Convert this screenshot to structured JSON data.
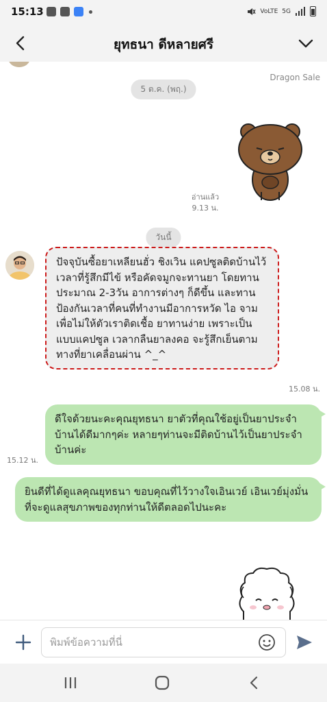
{
  "status_bar": {
    "time": "15:13",
    "network_label": "VoLTE",
    "signal_label": "5G"
  },
  "header": {
    "title": "ยุทธนา ดีหลายศรี",
    "back_icon": "chevron-left-icon",
    "menu_icon": "chevron-down-icon"
  },
  "chat": {
    "dragon_sale_label": "Dragon Sale",
    "date_old": "5 ต.ค. (พฤ.)",
    "read_label": "อ่านแล้ว",
    "read_time": "9.13 น.",
    "date_today": "วันนี้",
    "messages": [
      {
        "direction": "in",
        "text": "ปัจจุบันซื้อยาเหลียนฮั่ว ชิงเวิน แคปซูลติดบ้านไว้ เวลาที่รู้สึกมีไข้ หรือคัดจมูกจะทานยา โดยทานประมาณ 2-3วัน อาการต่างๆ ก็ดีขึ้น และทานป้องกันเวลาที่คนที่ทำงานมีอาการหวัด ไอ จาม เพื่อไม่ให้ตัวเราติดเชื้อ ยาทานง่าย เพราะเป็นแบบแคปซูล เวลากลืนยาลงคอ จะรู้สึกเย็นตามทางที่ยาเคลื่อนผ่าน ^_^",
        "time": "15.08 น."
      },
      {
        "direction": "out",
        "text": "ดีใจด้วยนะคะคุณยุทธนา ยาตัวที่คุณใช้อยู่เป็นยาประจำบ้านได้ดีมากๆค่ะ หลายๆท่านจะมีติดบ้านไว้เป็นยาประจำบ้านค่ะ",
        "time": "15.12 น."
      },
      {
        "direction": "out",
        "text": "ยินดีที่ได้ดูแลคุณยุทธนา ขอบคุณที่ไว้วางใจเอินเวย์ เอินเวย์มุ่งมั่นที่จะดูแลสุขภาพของทุกท่านให้ดีตลอดไปนะคะ",
        "time": ""
      }
    ]
  },
  "input_bar": {
    "placeholder": "พิมพ์ข้อความที่นี่",
    "value": "",
    "plus_icon": "plus-icon",
    "emoji_icon": "emoji-icon",
    "send_icon": "send-icon"
  },
  "nav_bar": {
    "icons": [
      "recent-apps-icon",
      "home-icon",
      "back-icon"
    ]
  },
  "colors": {
    "outgoing_bubble": "#bce6b2",
    "incoming_bubble": "#eeeeee",
    "highlight_border": "#cc1a1a",
    "send_icon": "#5a6e8c"
  }
}
